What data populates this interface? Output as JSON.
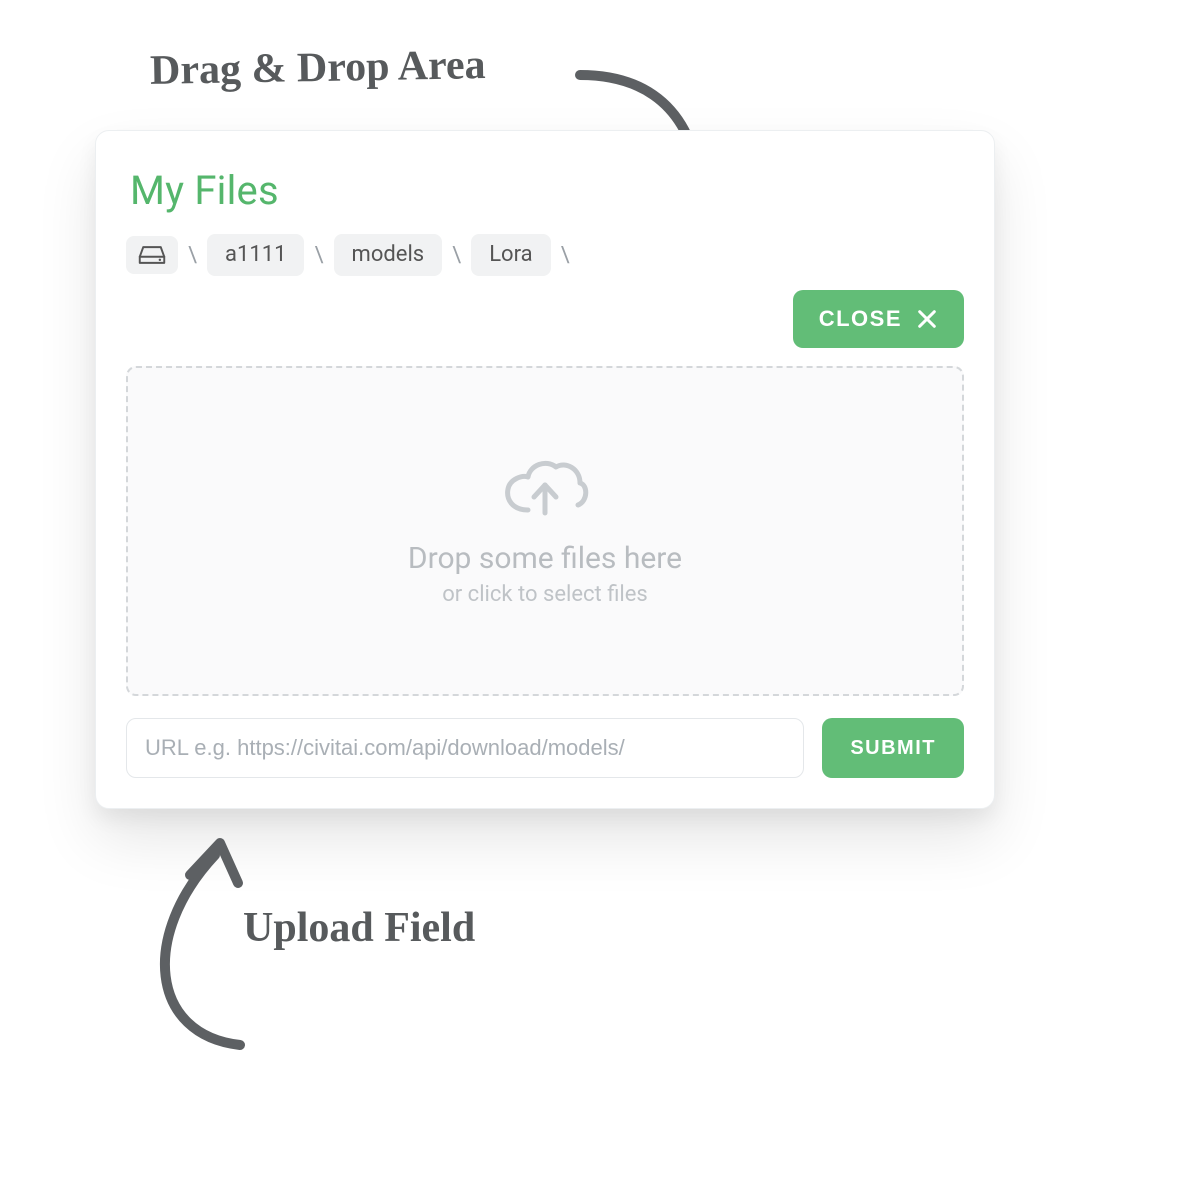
{
  "annotations": {
    "top": "Drag & Drop Area",
    "bottom": "Upload Field"
  },
  "panel": {
    "title": "My Files",
    "breadcrumb": {
      "separator": "\\",
      "items": [
        "a1111",
        "models",
        "Lora"
      ]
    },
    "close_label": "CLOSE",
    "dropzone": {
      "primary": "Drop some files here",
      "secondary": "or click to select files"
    },
    "url": {
      "placeholder": "URL e.g. https://civitai.com/api/download/models/",
      "value": ""
    },
    "submit_label": "SUBMIT"
  },
  "colors": {
    "accent": "#62bd77",
    "title": "#55b66c"
  }
}
